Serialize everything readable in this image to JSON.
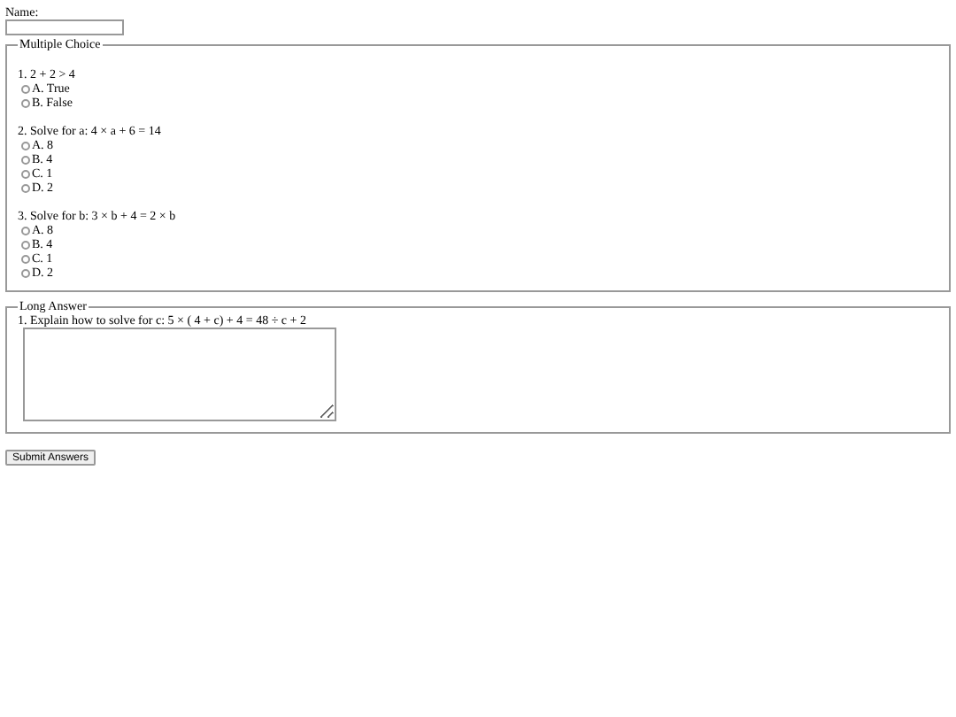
{
  "name_field": {
    "label": "Name:"
  },
  "multiple_choice": {
    "legend": "Multiple Choice",
    "questions": [
      {
        "prompt": "1. 2 + 2 > 4",
        "options": [
          {
            "label": "A. True",
            "selected": false
          },
          {
            "label": "B. False",
            "selected": false
          }
        ]
      },
      {
        "prompt": "2. Solve for a: 4 × a + 6 = 14",
        "options": [
          {
            "label": "A. 8",
            "selected": false
          },
          {
            "label": "B. 4",
            "selected": false
          },
          {
            "label": "C. 1",
            "selected": false
          },
          {
            "label": "D. 2",
            "selected": false
          }
        ]
      },
      {
        "prompt": "3. Solve for b: 3 × b + 4 = 2 × b",
        "options": [
          {
            "label": "A. 8",
            "selected": false
          },
          {
            "label": "B. 4",
            "selected": false
          },
          {
            "label": "C. 1",
            "selected": false
          },
          {
            "label": "D. 2",
            "selected": false
          }
        ]
      }
    ]
  },
  "long_answer": {
    "legend": "Long Answer",
    "questions": [
      {
        "prompt": "1. Explain how to solve for c: 5 × ( 4 + c) + 4 = 48 ÷ c + 2"
      }
    ]
  },
  "submit_button": {
    "label": "Submit Answers"
  }
}
